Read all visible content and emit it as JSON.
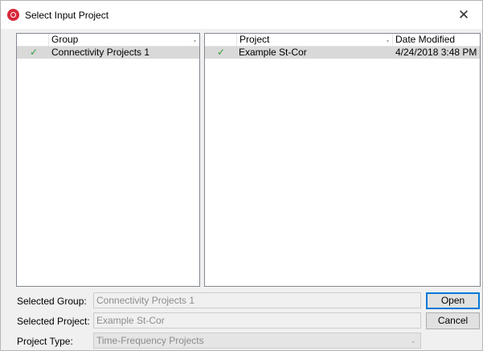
{
  "window": {
    "title": "Select Input Project",
    "close_symbol": "✕",
    "brand_color": "#d8283b"
  },
  "groups_panel": {
    "columns": [
      "",
      "Group"
    ],
    "rows": [
      {
        "check": "✓",
        "name": "Connectivity Projects 1",
        "selected": true
      }
    ]
  },
  "projects_panel": {
    "columns": [
      "",
      "Project",
      "Date Modified"
    ],
    "rows": [
      {
        "check": "✓",
        "name": "Example St-Cor",
        "date_modified": "4/24/2018 3:48 PM",
        "selected": true
      }
    ]
  },
  "form": {
    "selected_group_label": "Selected Group:",
    "selected_group_value": "Connectivity Projects 1",
    "selected_project_label": "Selected Project:",
    "selected_project_value": "Example St-Cor",
    "project_type_label": "Project Type:",
    "project_type_value": "Time-Frequency Projects"
  },
  "buttons": {
    "open": "Open",
    "cancel": "Cancel"
  },
  "icons": {
    "app": "app-logo-icon",
    "close": "close-icon",
    "check": "checkmark-icon",
    "dropdown": "chevron-down-icon",
    "sort": "sort-indicator-icon"
  }
}
